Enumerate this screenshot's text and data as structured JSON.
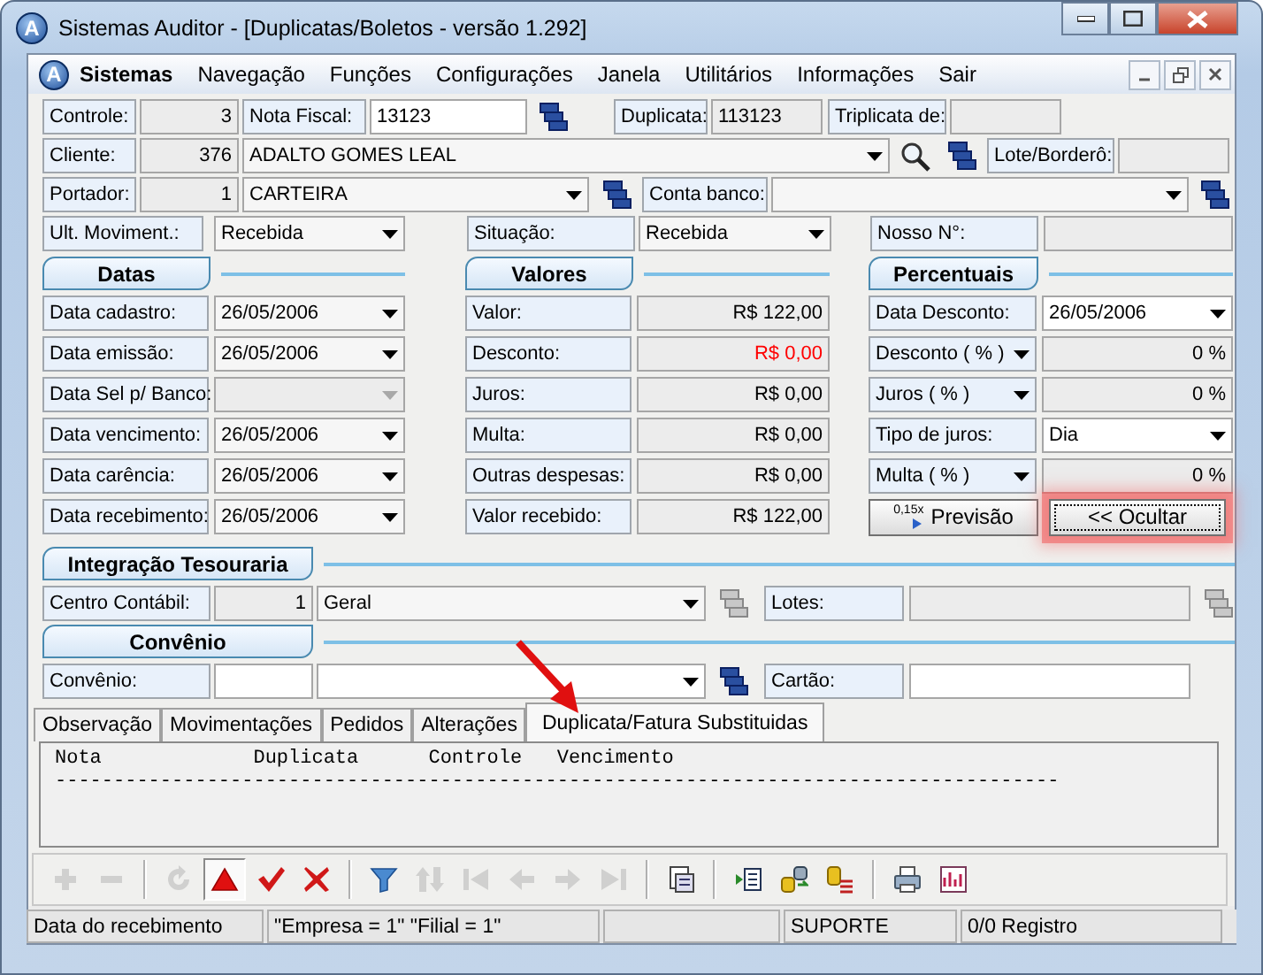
{
  "window": {
    "logo": "A",
    "title": "Sistemas Auditor - [Duplicatas/Boletos - versão 1.292]"
  },
  "menu": {
    "logo": "A",
    "app": "Sistemas",
    "items": [
      "Navegação",
      "Funções",
      "Configurações",
      "Janela",
      "Utilitários",
      "Informações",
      "Sair"
    ]
  },
  "header": {
    "controle": {
      "label": "Controle:",
      "value": "3"
    },
    "nota_fiscal": {
      "label": "Nota Fiscal:",
      "value": "13123"
    },
    "duplicata": {
      "label": "Duplicata:",
      "value": "113123"
    },
    "triplicata": {
      "label": "Triplicata de:"
    },
    "cliente": {
      "label": "Cliente:",
      "code": "376",
      "name": "ADALTO GOMES LEAL"
    },
    "lote": {
      "label": "Lote/Borderô:"
    },
    "portador": {
      "label": "Portador:",
      "code": "1",
      "name": "CARTEIRA"
    },
    "conta_banco": {
      "label": "Conta banco:"
    },
    "ult_moviment": {
      "label": "Ult. Moviment.:",
      "value": "Recebida"
    },
    "situacao": {
      "label": "Situação:",
      "value": "Recebida"
    },
    "nosso_numero": {
      "label": "Nosso N°:"
    }
  },
  "datas": {
    "title": "Datas",
    "rows": [
      {
        "label": "Data cadastro:",
        "value": "26/05/2006",
        "disabled": false
      },
      {
        "label": "Data emissão:",
        "value": "26/05/2006",
        "disabled": false
      },
      {
        "label": "Data Sel p/ Banco:",
        "disabled": true
      },
      {
        "label": "Data vencimento:",
        "value": "26/05/2006",
        "disabled": false
      },
      {
        "label": "Data carência:",
        "value": "26/05/2006",
        "disabled": false
      },
      {
        "label": "Data recebimento:",
        "value": "26/05/2006",
        "disabled": false
      }
    ]
  },
  "valores": {
    "title": "Valores",
    "rows": [
      {
        "label": "Valor:",
        "value": "R$ 122,00",
        "color": "#000000"
      },
      {
        "label": "Desconto:",
        "value": "R$ 0,00",
        "color": "#ff0000"
      },
      {
        "label": "Juros:",
        "value": "R$ 0,00",
        "color": "#000000"
      },
      {
        "label": "Multa:",
        "value": "R$ 0,00",
        "color": "#000000"
      },
      {
        "label": "Outras despesas:",
        "value": "R$ 0,00",
        "color": "#000000"
      },
      {
        "label": "Valor recebido:",
        "value": "R$ 122,00",
        "color": "#000000"
      }
    ]
  },
  "percentuais": {
    "title": "Percentuais",
    "rows": [
      {
        "kind": "date",
        "label": "Data Desconto:",
        "label_dropdown": false,
        "value": "26/05/2006"
      },
      {
        "kind": "percent",
        "label": "Desconto ( % )",
        "label_dropdown": true,
        "value": "0 %"
      },
      {
        "kind": "percent",
        "label": "Juros ( % )",
        "label_dropdown": true,
        "value": "0 %"
      },
      {
        "kind": "combo",
        "label": "Tipo de juros:",
        "label_dropdown": false,
        "value": "Dia"
      },
      {
        "kind": "percent",
        "label": "Multa ( % )",
        "label_dropdown": true,
        "value": "0 %"
      }
    ],
    "buttons": [
      {
        "kind": "preview",
        "label": "Previsão",
        "badge": "0,15x",
        "highlighted": false,
        "focused": false
      },
      {
        "kind": "hide",
        "label": "<< Ocultar",
        "highlighted": true,
        "focused": true
      }
    ]
  },
  "integracao": {
    "title": "Integração Tesouraria",
    "centro": {
      "label": "Centro Contábil:",
      "code": "1",
      "value": "Geral",
      "picker_disabled": true
    },
    "lotes": {
      "label": "Lotes:",
      "picker_disabled": true
    }
  },
  "convenio": {
    "title": "Convênio",
    "convenio": {
      "label": "Convênio:",
      "picker_disabled": false
    },
    "cartao": {
      "label": "Cartão:"
    }
  },
  "annotation_arrow": true,
  "tabs": [
    {
      "label": "Observação",
      "selected": false
    },
    {
      "label": "Movimentações",
      "selected": false
    },
    {
      "label": "Pedidos",
      "selected": false
    },
    {
      "label": "Alterações",
      "selected": false
    },
    {
      "label": "Duplicata/Fatura Substituidas",
      "selected": true
    }
  ],
  "memo": {
    "lines": [
      "Nota             Duplicata      Controle   Vencimento",
      "--------------------------------------------------------------------------------------"
    ]
  },
  "toolbar": [
    {
      "kind": "add",
      "disabled": true
    },
    {
      "kind": "remove",
      "disabled": true
    },
    {
      "kind": "separator"
    },
    {
      "kind": "refresh",
      "disabled": true
    },
    {
      "kind": "up",
      "disabled": false,
      "pressed": true
    },
    {
      "kind": "confirm",
      "disabled": false,
      "pressed": false
    },
    {
      "kind": "cancel",
      "disabled": false,
      "pressed": false
    },
    {
      "kind": "separator"
    },
    {
      "kind": "filter",
      "disabled": false,
      "pressed": false
    },
    {
      "kind": "sort",
      "disabled": true
    },
    {
      "kind": "first",
      "disabled": true
    },
    {
      "kind": "prev",
      "disabled": true
    },
    {
      "kind": "next",
      "disabled": true
    },
    {
      "kind": "last",
      "disabled": true
    },
    {
      "kind": "separator"
    },
    {
      "kind": "document",
      "disabled": false,
      "pressed": false
    },
    {
      "kind": "separator"
    },
    {
      "kind": "list",
      "disabled": false,
      "pressed": false
    },
    {
      "kind": "transfer",
      "disabled": false,
      "pressed": false
    },
    {
      "kind": "dblist",
      "disabled": false,
      "pressed": false
    },
    {
      "kind": "separator"
    },
    {
      "kind": "print",
      "disabled": false,
      "pressed": false
    },
    {
      "kind": "chart",
      "disabled": false,
      "pressed": false
    }
  ],
  "status_bar": [
    {
      "text": "Data do recebimento"
    },
    {
      "text": "\"Empresa = 1\"   \"Filial = 1\""
    },
    {
      "text": "SUPORTE"
    },
    {
      "text": "0/0 Registro"
    }
  ]
}
